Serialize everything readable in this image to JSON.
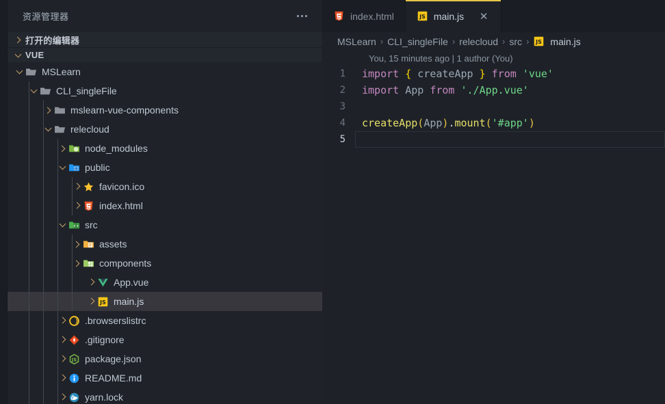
{
  "sidebar": {
    "title": "资源管理器",
    "more_actions_icon": "ellipsis-icon",
    "sections": [
      {
        "label": "打开的编辑器",
        "expanded": false
      },
      {
        "label": "VUE",
        "expanded": true
      }
    ],
    "tree": [
      {
        "label": "MSLearn",
        "icon": "folder-open-icon",
        "indent": 1,
        "twisty": "down",
        "depth_guides": 0
      },
      {
        "label": "CLI_singleFile",
        "icon": "folder-open-icon",
        "indent": 2,
        "twisty": "down",
        "depth_guides": 1
      },
      {
        "label": "mslearn-vue-components",
        "icon": "folder-icon",
        "indent": 3,
        "twisty": "right",
        "depth_guides": 2
      },
      {
        "label": "relecloud",
        "icon": "folder-open-icon",
        "indent": 3,
        "twisty": "down",
        "depth_guides": 2
      },
      {
        "label": "node_modules",
        "icon": "folder-node-icon",
        "indent": 4,
        "twisty": "right",
        "depth_guides": 3
      },
      {
        "label": "public",
        "icon": "folder-public-icon",
        "indent": 4,
        "twisty": "down",
        "depth_guides": 3
      },
      {
        "label": "favicon.ico",
        "icon": "favicon-star-icon",
        "indent": 5,
        "twisty": "none",
        "depth_guides": 4
      },
      {
        "label": "index.html",
        "icon": "html5-icon",
        "indent": 5,
        "twisty": "none",
        "depth_guides": 4
      },
      {
        "label": "src",
        "icon": "folder-src-icon",
        "indent": 4,
        "twisty": "down",
        "depth_guides": 3
      },
      {
        "label": "assets",
        "icon": "folder-assets-icon",
        "indent": 5,
        "twisty": "right",
        "depth_guides": 4
      },
      {
        "label": "components",
        "icon": "folder-components-icon",
        "indent": 5,
        "twisty": "right",
        "depth_guides": 4
      },
      {
        "label": "App.vue",
        "icon": "vue-icon",
        "indent": 6,
        "twisty": "none",
        "depth_guides": 4
      },
      {
        "label": "main.js",
        "icon": "javascript-icon",
        "indent": 6,
        "twisty": "none",
        "depth_guides": 4,
        "selected": true
      },
      {
        "label": ".browserslistrc",
        "icon": "browserslist-icon",
        "indent": 4,
        "twisty": "none",
        "depth_guides": 3
      },
      {
        "label": ".gitignore",
        "icon": "git-icon",
        "indent": 4,
        "twisty": "none",
        "depth_guides": 3
      },
      {
        "label": "package.json",
        "icon": "nodejs-icon",
        "indent": 4,
        "twisty": "none",
        "depth_guides": 3
      },
      {
        "label": "README.md",
        "icon": "info-icon",
        "indent": 4,
        "twisty": "none",
        "depth_guides": 3
      },
      {
        "label": "yarn.lock",
        "icon": "yarn-icon",
        "indent": 4,
        "twisty": "none",
        "depth_guides": 3
      }
    ]
  },
  "editor": {
    "tabs": [
      {
        "label": "index.html",
        "icon": "html5-icon",
        "active": false,
        "closable": false
      },
      {
        "label": "main.js",
        "icon": "javascript-icon",
        "active": true,
        "closable": true,
        "close_glyph": "✕"
      }
    ],
    "breadcrumb": {
      "separator": "›",
      "items": [
        "MSLearn",
        "CLI_singleFile",
        "relecloud",
        "src",
        "main.js"
      ],
      "file_icon": "javascript-icon"
    },
    "blame": "You, 15 minutes ago | 1 author (You)",
    "lines": [
      {
        "number": "1",
        "tokens": [
          {
            "text": "import ",
            "cls": "t-kw"
          },
          {
            "text": "{ ",
            "cls": "t-brace"
          },
          {
            "text": "createApp",
            "cls": "t-ident"
          },
          {
            "text": " }",
            "cls": "t-brace"
          },
          {
            "text": " from ",
            "cls": "t-kw"
          },
          {
            "text": "'vue'",
            "cls": "t-str"
          }
        ]
      },
      {
        "number": "2",
        "tokens": [
          {
            "text": "import ",
            "cls": "t-kw"
          },
          {
            "text": "App ",
            "cls": "t-ident"
          },
          {
            "text": "from ",
            "cls": "t-kw"
          },
          {
            "text": "'./App.vue'",
            "cls": "t-str"
          }
        ]
      },
      {
        "number": "3",
        "tokens": []
      },
      {
        "number": "4",
        "tokens": [
          {
            "text": "createApp",
            "cls": "t-fn"
          },
          {
            "text": "(",
            "cls": "t-paren"
          },
          {
            "text": "App",
            "cls": "t-var"
          },
          {
            "text": ")",
            "cls": "t-paren"
          },
          {
            "text": ".",
            "cls": "t-punct"
          },
          {
            "text": "mount",
            "cls": "t-fn"
          },
          {
            "text": "(",
            "cls": "t-paren"
          },
          {
            "text": "'#app'",
            "cls": "t-str"
          },
          {
            "text": ")",
            "cls": "t-paren"
          }
        ]
      },
      {
        "number": "5",
        "tokens": [],
        "current": true
      }
    ]
  },
  "colors": {
    "accent_tab_border": "#e8c547",
    "sidebar_bg": "#1f2329",
    "editor_bg": "#1e2228",
    "selection_bg": "#37373d",
    "string": "#6fd68a",
    "keyword": "#c586c0",
    "function": "#e8e06a"
  }
}
